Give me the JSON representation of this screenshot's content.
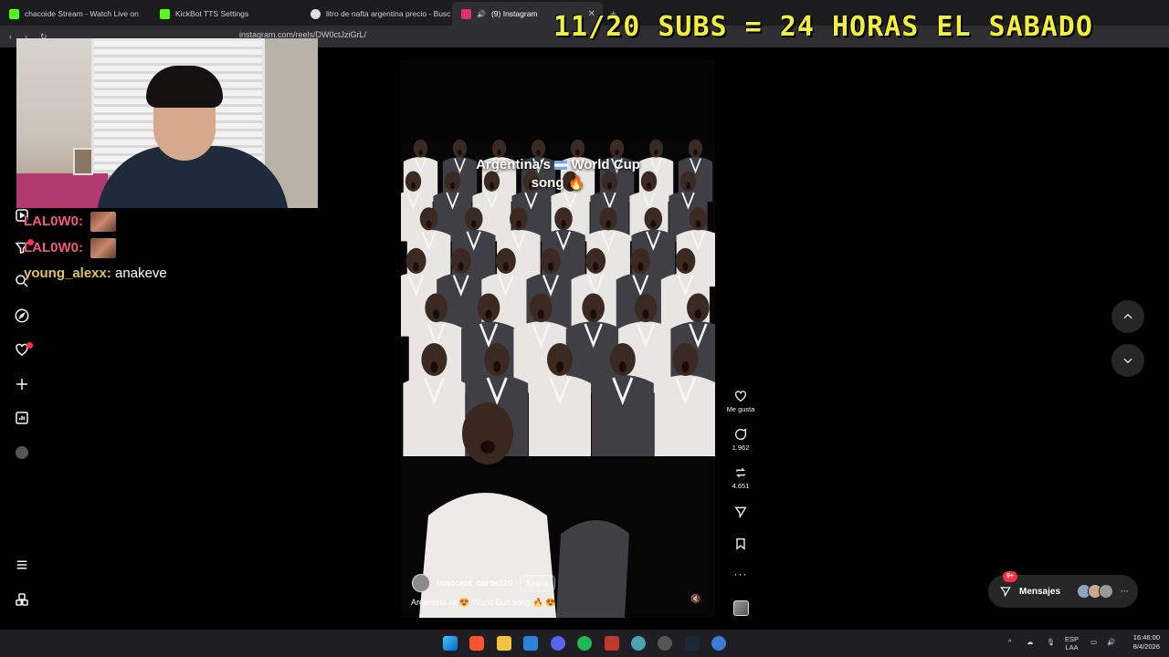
{
  "browser": {
    "tabs": [
      {
        "label": "chacoide Stream - Watch Live on",
        "favicon_color": "#53fc18"
      },
      {
        "label": "KickBot TTS Settings",
        "favicon_color": "#53fc18"
      },
      {
        "label": "litro de nafta argentina precio - Busc",
        "favicon_color": "#dddddd"
      },
      {
        "label": "(9) Instagram",
        "favicon_color": "#e1306c",
        "active": true
      }
    ],
    "new_tab": "+",
    "url": "instagram.com/reels/DW0ctJziGrL/"
  },
  "overlay": {
    "banner": "11/20 SUBS = 24 HORAS EL SABADO"
  },
  "chat": [
    {
      "user": "LAL0W0:",
      "message": "",
      "emote": true
    },
    {
      "user": "LAL0W0:",
      "message": "",
      "emote": true
    },
    {
      "user": "young_alexx:",
      "message": "anakeve",
      "emote": false
    }
  ],
  "reel": {
    "overlay_caption_1": "Argentina's",
    "overlay_caption_2": "World Cup",
    "overlay_caption_3": "song 🔥",
    "author": "innocent_cordell20",
    "follow_label": "Seguir",
    "description": "Argentina ᴀʀ 😍 World Cup song 🔥 😍",
    "mute_icon": "speaker-muted-icon"
  },
  "actions": {
    "like_label": "Me gusta",
    "comments": "1.962",
    "reposts": "4.651"
  },
  "messages": {
    "label": "Mensajes",
    "badge": "9+"
  },
  "taskbar": {
    "lang_1": "ESP",
    "lang_2": "LAA",
    "time": "16:46:00",
    "date": "8/4/2026"
  },
  "colors": {
    "banner": "#f3f03c",
    "accent_red": "#ff3040",
    "chat_user": "#f05a7a",
    "chat_user_2": "#e0c15a"
  }
}
